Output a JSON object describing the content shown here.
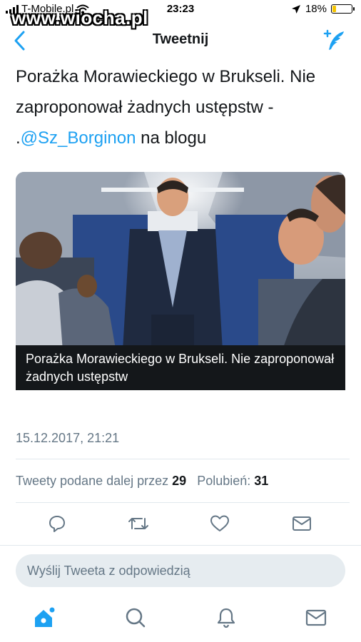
{
  "status_bar": {
    "carrier": "T-Mobile.pl",
    "time": "23:23",
    "battery": "18%",
    "battery_fraction": 0.18
  },
  "watermark": "www.wiocha.pl",
  "navbar": {
    "title": "Tweetnij",
    "back_icon": "chevron-left-icon",
    "compose_icon": "compose-tweet-icon"
  },
  "tweet": {
    "text_part1": "Porażka Morawieckiego w Brukseli. Nie zaproponował żadnych ustępstw - .",
    "mention": "@Sz_Borginon",
    "text_part2": " na blogu",
    "card": {
      "caption": "Porażka Morawieckiego w Brukseli. Nie zaproponował żadnych ustępstw"
    },
    "date": "15.12.2017, 21:21",
    "stats": {
      "retweets_label": "Tweety podane dalej przez",
      "retweets_count": "29",
      "likes_label": "Polubień:",
      "likes_count": "31"
    }
  },
  "actions": [
    "reply-icon",
    "retweet-icon",
    "like-icon",
    "message-icon"
  ],
  "reply_box": {
    "placeholder": "Wyślij Tweeta z odpowiedzią"
  },
  "tabbar": [
    "home-icon",
    "search-icon",
    "notifications-icon",
    "messages-icon"
  ],
  "colors": {
    "accent": "#1da1f2",
    "text": "#14171a",
    "secondary": "#657786",
    "divider": "#e1e8ed",
    "battery_low": "#f5c400"
  }
}
